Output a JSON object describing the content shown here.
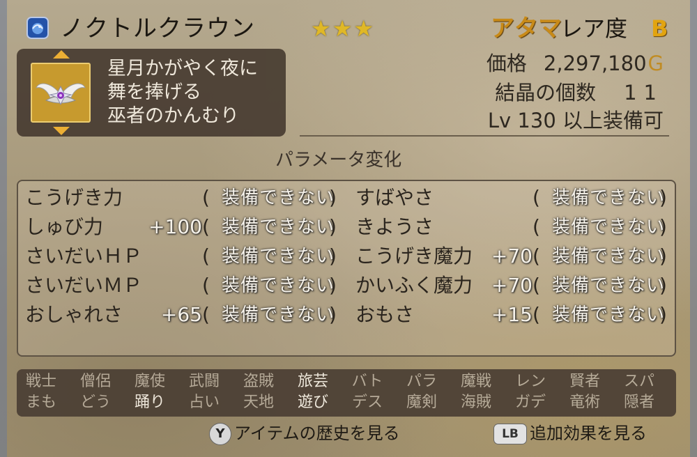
{
  "item": {
    "name": "ノクトルクラウン",
    "stars": "★★★",
    "slot": "アタマ",
    "rarity_label": "レア度",
    "rarity": "B",
    "description": [
      "星月かがやく夜に",
      "舞を捧げる",
      "巫者のかんむり"
    ]
  },
  "info": {
    "price_label": "価格",
    "price": "2,297,180",
    "currency": "G",
    "crystal_label": "結晶の個数",
    "crystal_count": "11",
    "level_requirement": "Lv 130 以上装備可"
  },
  "params": {
    "title": "パラメータ変化",
    "open_paren": "(",
    "close_paren": ")",
    "left": [
      {
        "name": "こうげき力",
        "bonus": "",
        "status": "装備できない"
      },
      {
        "name": "しゅび力",
        "bonus": "+100",
        "status": "装備できない"
      },
      {
        "name": "さいだいＨＰ",
        "bonus": "",
        "status": "装備できない"
      },
      {
        "name": "さいだいＭＰ",
        "bonus": "",
        "status": "装備できない"
      },
      {
        "name": "おしゃれさ",
        "bonus": "+65",
        "status": "装備できない"
      }
    ],
    "right": [
      {
        "name": "すばやさ",
        "bonus": "",
        "status": "装備できない"
      },
      {
        "name": "きようさ",
        "bonus": "",
        "status": "装備できない"
      },
      {
        "name": "こうげき魔力",
        "bonus": "+70",
        "status": "装備できない"
      },
      {
        "name": "かいふく魔力",
        "bonus": "+70",
        "status": "装備できない"
      },
      {
        "name": "おもさ",
        "bonus": "+15",
        "status": "装備できない"
      }
    ]
  },
  "jobs": {
    "row1": [
      "戦士",
      "僧侶",
      "魔使",
      "武闘",
      "盗賊",
      "旅芸",
      "バト",
      "パラ",
      "魔戦",
      "レン",
      "賢者",
      "スパ"
    ],
    "row2": [
      "まも",
      "どう",
      "踊り",
      "占い",
      "天地",
      "遊び",
      "デス",
      "魔剣",
      "海賊",
      "ガデ",
      "竜術",
      "隠者"
    ],
    "row1_active": [
      false,
      false,
      false,
      false,
      false,
      true,
      false,
      false,
      false,
      false,
      false,
      false
    ],
    "row2_active": [
      false,
      false,
      true,
      false,
      false,
      true,
      false,
      false,
      false,
      false,
      false,
      false
    ]
  },
  "hints": {
    "history_button": "Y",
    "history_label": "アイテムの歴史を見る",
    "effects_button": "LB",
    "effects_label": "追加効果を見る"
  },
  "colors": {
    "accent_gold": "#e2a410",
    "slot_orange": "#c88a18",
    "panel_dark": "#4b3f34"
  }
}
